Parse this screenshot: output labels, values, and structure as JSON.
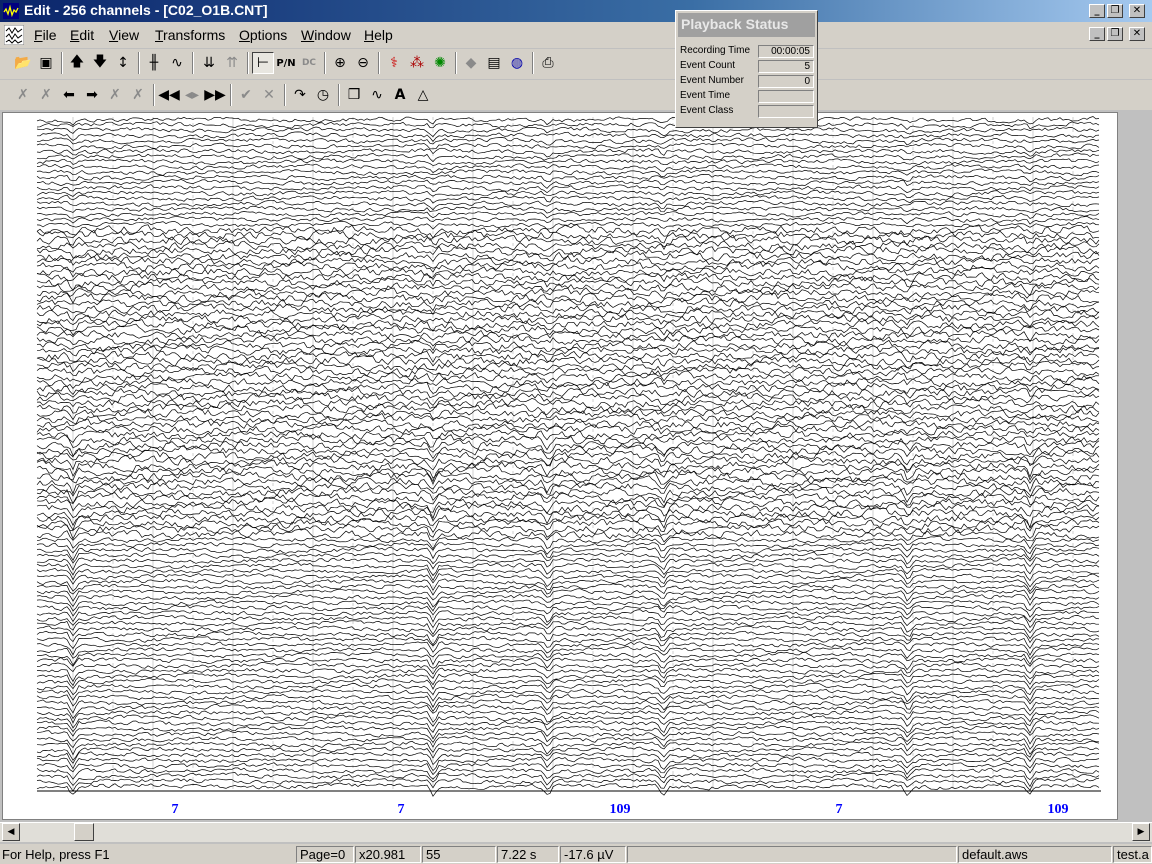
{
  "window": {
    "title": "Edit - 256 channels - [C02_O1B.CNT]",
    "caption_buttons": [
      "minimize",
      "restore",
      "close"
    ]
  },
  "menu": [
    "File",
    "Edit",
    "View",
    "Transforms",
    "Options",
    "Window",
    "Help"
  ],
  "toolbar1_icons": [
    "open-icon",
    "save-icon",
    "arrow-up-icon",
    "arrow-down-icon",
    "arrow-updown-icon",
    "spike-icon",
    "wave-icon",
    "list-down-icon",
    "list-up-icon",
    "baseline-icon",
    "pn-icon",
    "dc-icon",
    "zoom-in-icon",
    "zoom-out-icon",
    "map-icon",
    "dots-map-icon",
    "color-map-icon",
    "cube-icon",
    "notes-icon",
    "globe-icon",
    "print-icon"
  ],
  "toolbar1_labels": {
    "pn": "P/N",
    "dc": "DC"
  },
  "toolbar2_icons": [
    "mark-icon",
    "mark-all-icon",
    "arrow-left-icon",
    "arrow-right-icon",
    "delete-mark-icon",
    "mark-range-icon",
    "rewind-icon",
    "step-icon",
    "fast-forward-icon",
    "accept-icon",
    "reject-icon",
    "redo-icon",
    "clock-icon",
    "box-icon",
    "wave-edit-icon",
    "text-icon",
    "triangle-icon"
  ],
  "toolbar2_labels": {
    "text": "A"
  },
  "event_markers": [
    {
      "label": "7"
    },
    {
      "label": "7"
    },
    {
      "label": "109"
    },
    {
      "label": "7"
    },
    {
      "label": "109"
    }
  ],
  "playback": {
    "title": "Playback Status",
    "rows": [
      {
        "label": "Recording Time",
        "value": "00:00:05"
      },
      {
        "label": "Event Count",
        "value": "5"
      },
      {
        "label": "Event Number",
        "value": "0"
      },
      {
        "label": "Event Time",
        "value": ""
      },
      {
        "label": "Event Class",
        "value": ""
      }
    ]
  },
  "status": {
    "help": "For Help, press F1",
    "page": "Page=0",
    "scale": "x20.981",
    "channel": "55",
    "time": "7.22 s",
    "amplitude": "-17.6 µV",
    "workspace": "default.aws",
    "file": "test.a"
  },
  "colors": {
    "title_bar": "#0a246a",
    "marker_text": "#0000ff",
    "trace": "#000000"
  }
}
